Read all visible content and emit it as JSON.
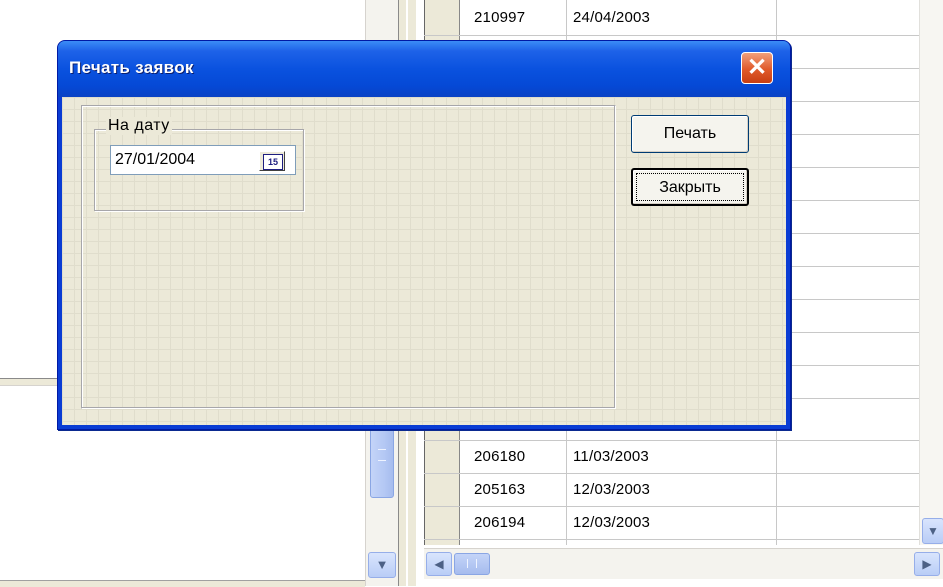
{
  "dialog": {
    "title": "Печать заявок",
    "close_glyph": "✕",
    "group_label": "На дату",
    "date_value": "27/01/2004",
    "calendar_glyph": "15",
    "print_label": "Печать",
    "close_label": "Закрыть"
  },
  "grid": {
    "rows": [
      {
        "id": "210997",
        "date": "24/04/2003"
      },
      {
        "id": "206180",
        "date": "11/03/2003"
      },
      {
        "id": "205163",
        "date": "12/03/2003"
      },
      {
        "id": "206194",
        "date": "12/03/2003"
      }
    ]
  },
  "icons": {
    "close": "close-icon",
    "calendar": "calendar-icon",
    "scroll_down": "chevron-down-icon",
    "scroll_left": "chevron-left-icon",
    "scroll_right": "chevron-right-icon"
  },
  "colors": {
    "titlebar": "#0a52df",
    "close_button": "#e05a2a",
    "dialog_face": "#ece9d8"
  }
}
